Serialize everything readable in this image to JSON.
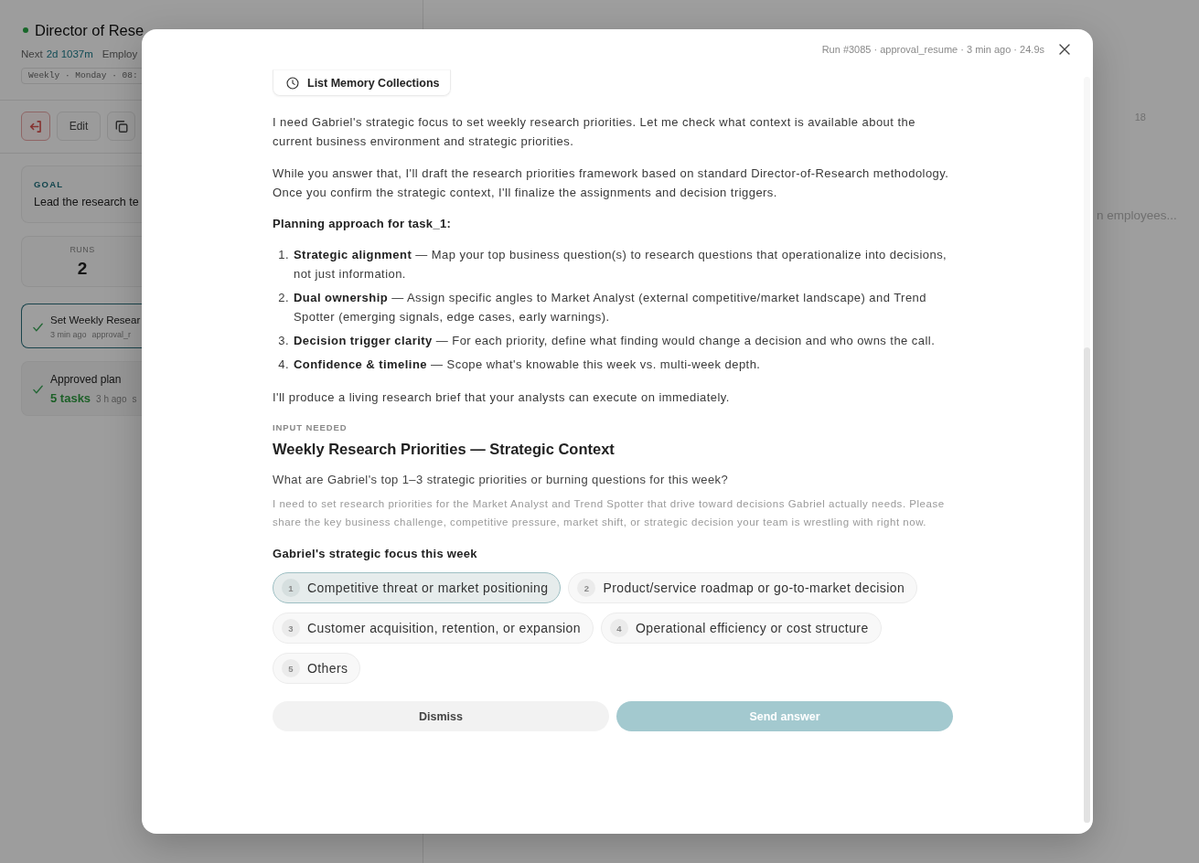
{
  "agent_panel": {
    "title": "Director of Rese",
    "next_label": "Next",
    "next_value": "2d 1037m",
    "detail": "Employ",
    "schedule": "Weekly · Monday · 08:",
    "edit_button": "Edit",
    "goal": {
      "label": "GOAL",
      "text": "Lead the research te"
    },
    "stats": [
      {
        "label": "RUNS",
        "value": "2"
      }
    ],
    "runs": [
      {
        "title": "Set Weekly Resear",
        "time": "3 min ago",
        "detail": "approval_r",
        "selected": true
      },
      {
        "title": "Approved plan",
        "tasks": "5 tasks",
        "time": "3 h ago",
        "detail": "s",
        "selected": false
      }
    ]
  },
  "employees_panel": {
    "count": "18",
    "search": {
      "placeholder": "n employees..."
    }
  },
  "dialog": {
    "meta": "Run #3085 · approval_resume · 3 min ago · 24.9s",
    "tool_call": "List Memory Collections",
    "paragraphs": [
      "I need Gabriel's strategic focus to set weekly research priorities. Let me check what context is available about the current business environment and strategic priorities.",
      "While you answer that, I'll draft the research priorities framework based on standard Director-of-Research methodology. Once you confirm the strategic context, I'll finalize the assignments and decision triggers."
    ],
    "plan_heading": "Planning approach for task_1:",
    "plan_items": [
      {
        "number": "1.",
        "text": "**Strategic alignment** — Map your top business question(s) to research questions that operationalize into decisions, not just information."
      },
      {
        "number": "2.",
        "text": "**Dual ownership** — Assign specific angles to Market Analyst (external competitive/market landscape) and Trend Spotter (emerging signals, edge cases, early warnings)."
      },
      {
        "number": "3.",
        "text": "**Decision trigger clarity** — For each priority, define what finding would change a decision and who owns the call."
      },
      {
        "number": "4.",
        "text": "**Confidence & timeline** — Scope what's knowable this week vs. multi-week depth."
      }
    ],
    "closing": "I'll produce a living research brief that your analysts can execute on immediately.",
    "input": {
      "label": "INPUT NEEDED",
      "title": "Weekly Research Priorities — Strategic Context",
      "question": "What are Gabriel's top 1–3 strategic priorities or burning questions for this week?",
      "description": "I need to set research priorities for the Market Analyst and Trend Spotter that drive toward decisions Gabriel actually needs. Please share the key business challenge, competitive pressure, market shift, or strategic decision your team is wrestling with right now.",
      "options_label": "Gabriel's strategic focus this week",
      "options": [
        {
          "number": "1",
          "text": "Competitive threat or market positioning",
          "selected": true
        },
        {
          "number": "2",
          "text": "Product/service roadmap or go-to-market decision",
          "selected": false
        },
        {
          "number": "3",
          "text": "Customer acquisition, retention, or expansion",
          "selected": false
        },
        {
          "number": "4",
          "text": "Operational efficiency or cost structure",
          "selected": false
        },
        {
          "number": "5",
          "text": "Others",
          "selected": false
        }
      ]
    },
    "actions": [
      {
        "kind": "secondary",
        "label": "Dismiss",
        "disabled": false
      },
      {
        "kind": "primary",
        "label": "Send answer",
        "disabled": true
      }
    ]
  }
}
